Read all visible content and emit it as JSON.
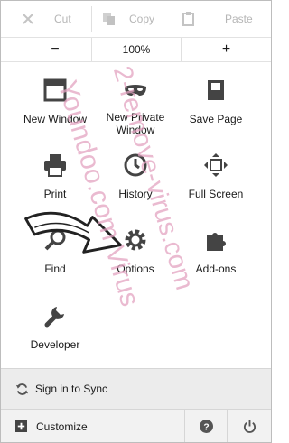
{
  "edit": {
    "cut": "Cut",
    "copy": "Copy",
    "paste": "Paste"
  },
  "zoom": {
    "minus": "−",
    "level": "100%",
    "plus": "+"
  },
  "grid": {
    "new_window": "New Window",
    "new_private_line1": "New Private",
    "new_private_line2": "Window",
    "save_page": "Save Page",
    "print": "Print",
    "history": "History",
    "full_screen": "Full Screen",
    "find": "Find",
    "options": "Options",
    "addons": "Add-ons",
    "developer": "Developer"
  },
  "footer": {
    "sync": "Sign in to Sync",
    "customize": "Customize"
  },
  "watermark": {
    "line1": "2-remove-virus.com",
    "line2": "Youndoo.com Virus"
  },
  "colors": {
    "icon": "#444444",
    "footer_bg": "#ececec",
    "watermark": "#e3a3c1"
  }
}
